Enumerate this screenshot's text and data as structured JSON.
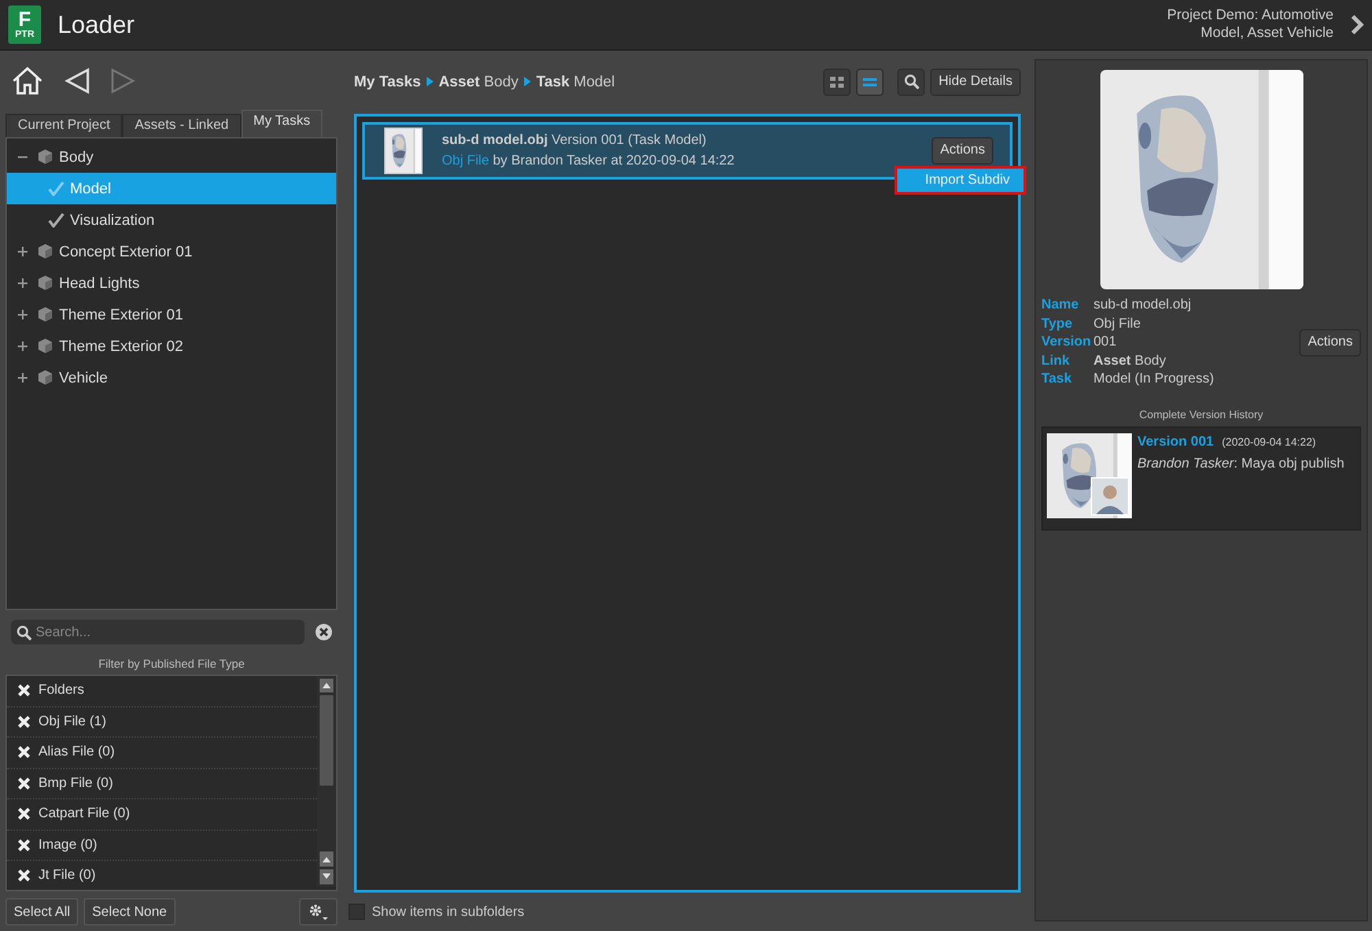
{
  "header": {
    "logo_letter": "F",
    "logo_sub": "PTR",
    "title": "Loader",
    "context_lines": [
      "Project Demo: Automotive",
      "Model, Asset Vehicle"
    ]
  },
  "tabs": [
    {
      "label": "Current Project",
      "selected": false
    },
    {
      "label": "Assets - Linked",
      "selected": false
    },
    {
      "label": "My Tasks",
      "selected": true
    }
  ],
  "tree": [
    {
      "label": "Body",
      "kind": "asset",
      "expanded": true,
      "selected": false,
      "children": [
        {
          "label": "Model",
          "kind": "task",
          "selected": true
        },
        {
          "label": "Visualization",
          "kind": "task",
          "selected": false
        }
      ]
    },
    {
      "label": "Concept Exterior 01",
      "kind": "asset",
      "expanded": false,
      "selected": false
    },
    {
      "label": "Head Lights",
      "kind": "asset",
      "expanded": false,
      "selected": false
    },
    {
      "label": "Theme Exterior 01",
      "kind": "asset",
      "expanded": false,
      "selected": false
    },
    {
      "label": "Theme Exterior 02",
      "kind": "asset",
      "expanded": false,
      "selected": false
    },
    {
      "label": "Vehicle",
      "kind": "asset",
      "expanded": false,
      "selected": false
    }
  ],
  "search": {
    "placeholder": "Search..."
  },
  "filter": {
    "title": "Filter by Published File Type",
    "items": [
      {
        "label": "Folders",
        "checked": true
      },
      {
        "label": "Obj File (1)",
        "checked": true
      },
      {
        "label": "Alias File (0)",
        "checked": true
      },
      {
        "label": "Bmp File (0)",
        "checked": true
      },
      {
        "label": "Catpart File (0)",
        "checked": true
      },
      {
        "label": "Image (0)",
        "checked": true
      },
      {
        "label": "Jt File (0)",
        "checked": true
      }
    ]
  },
  "buttons": [
    "Select All",
    "Select None"
  ],
  "breadcrumb": [
    {
      "name": "My Tasks"
    },
    {
      "type": "Asset",
      "name": "Body"
    },
    {
      "type": "Task",
      "name": "Model"
    }
  ],
  "view_buttons": [
    {
      "kind": "grid",
      "selected": false
    },
    {
      "kind": "list",
      "selected": true
    }
  ],
  "hide_details": "Hide Details",
  "files": [
    {
      "title": "**sub-d model.obj** Version 001 (Task Model)",
      "type_link": "Obj File",
      "byline": "by Brandon Tasker at 2020-09-04 14:22",
      "actions": "Actions",
      "selected": true
    }
  ],
  "menu": {
    "items": [
      {
        "label": "Import Subdiv",
        "selected": true
      }
    ]
  },
  "subfolders": {
    "label": "Show items in subfolders",
    "checked": false
  },
  "details": {
    "fields": [
      {
        "key": "Name",
        "value": "sub-d model.obj"
      },
      {
        "key": "Type",
        "value": "Obj File"
      },
      {
        "key": "Version",
        "value": "001"
      },
      {
        "key": "Link",
        "value": "**Asset** Body"
      },
      {
        "key": "Task",
        "value": "Model (In Progress)"
      }
    ],
    "actions": "Actions",
    "history_title": "Complete Version History",
    "history": [
      {
        "version": "Version 001",
        "date": "(2020-09-04 14:22)",
        "note": "*Brandon Tasker*: Maya obj publish"
      }
    ]
  }
}
